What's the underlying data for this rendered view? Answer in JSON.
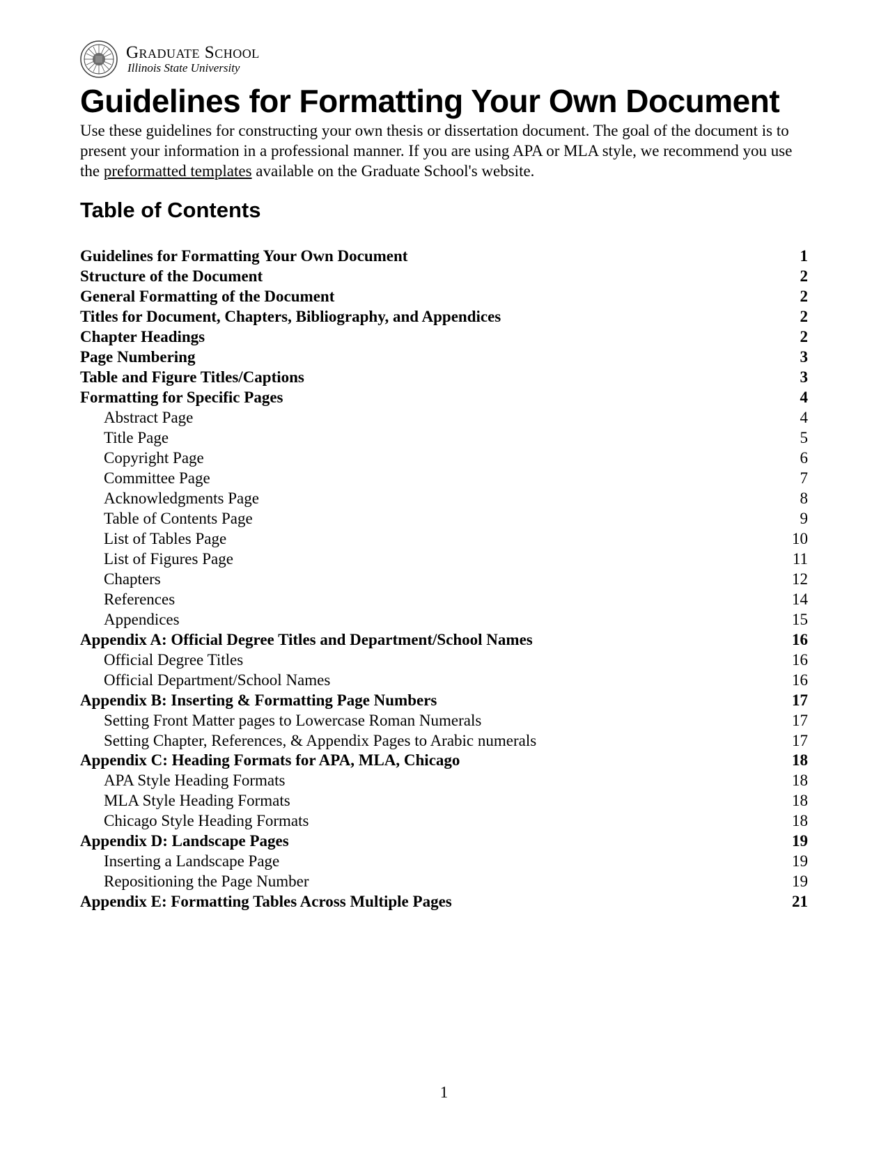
{
  "header": {
    "line1": "Graduate School",
    "line2": "Illinois State University"
  },
  "title": "Guidelines for Formatting Your Own Document",
  "intro": {
    "before_link": "Use these guidelines for constructing your own thesis or dissertation document. The goal of the document is to present your information in a professional manner. If you are using APA or MLA style, we recommend you use the ",
    "link_text": "preformatted templates",
    "after_link": " available on the Graduate School's website."
  },
  "toc_heading": "Table of Contents",
  "toc": [
    {
      "label": "Guidelines for Formatting Your Own Document",
      "page": "1",
      "bold": true,
      "indent": false
    },
    {
      "label": "Structure of the Document",
      "page": "2",
      "bold": true,
      "indent": false
    },
    {
      "label": "General Formatting of the Document",
      "page": "2",
      "bold": true,
      "indent": false
    },
    {
      "label": "Titles for Document, Chapters, Bibliography, and Appendices",
      "page": "2",
      "bold": true,
      "indent": false
    },
    {
      "label": "Chapter Headings",
      "page": "2",
      "bold": true,
      "indent": false
    },
    {
      "label": "Page Numbering",
      "page": "3",
      "bold": true,
      "indent": false
    },
    {
      "label": "Table and Figure Titles/Captions",
      "page": "3",
      "bold": true,
      "indent": false
    },
    {
      "label": "Formatting for Specific Pages",
      "page": "4",
      "bold": true,
      "indent": false
    },
    {
      "label": "Abstract Page",
      "page": "4",
      "bold": false,
      "indent": true
    },
    {
      "label": "Title Page",
      "page": "5",
      "bold": false,
      "indent": true
    },
    {
      "label": "Copyright Page",
      "page": "6",
      "bold": false,
      "indent": true
    },
    {
      "label": "Committee Page",
      "page": "7",
      "bold": false,
      "indent": true
    },
    {
      "label": "Acknowledgments Page",
      "page": "8",
      "bold": false,
      "indent": true
    },
    {
      "label": "Table of Contents Page",
      "page": "9",
      "bold": false,
      "indent": true
    },
    {
      "label": "List of Tables Page",
      "page": "10",
      "bold": false,
      "indent": true
    },
    {
      "label": "List of Figures Page",
      "page": "11",
      "bold": false,
      "indent": true
    },
    {
      "label": "Chapters",
      "page": "12",
      "bold": false,
      "indent": true
    },
    {
      "label": "References",
      "page": "14",
      "bold": false,
      "indent": true
    },
    {
      "label": "Appendices",
      "page": "15",
      "bold": false,
      "indent": true
    },
    {
      "label": "Appendix A: Official Degree Titles and Department/School Names",
      "page": "16",
      "bold": true,
      "indent": false
    },
    {
      "label": "Official Degree Titles",
      "page": "16",
      "bold": false,
      "indent": true
    },
    {
      "label": "Official Department/School Names",
      "page": "16",
      "bold": false,
      "indent": true
    },
    {
      "label": "Appendix B: Inserting & Formatting Page Numbers",
      "page": "17",
      "bold": true,
      "indent": false
    },
    {
      "label": "Setting Front Matter pages to Lowercase Roman Numerals",
      "page": "17",
      "bold": false,
      "indent": true
    },
    {
      "label": "Setting Chapter, References, & Appendix Pages to Arabic numerals",
      "page": "17",
      "bold": false,
      "indent": true
    },
    {
      "label": "Appendix C: Heading Formats for APA, MLA, Chicago",
      "page": "18",
      "bold": true,
      "indent": false
    },
    {
      "label": "APA Style Heading Formats",
      "page": "18",
      "bold": false,
      "indent": true
    },
    {
      "label": "MLA Style Heading Formats",
      "page": "18",
      "bold": false,
      "indent": true
    },
    {
      "label": "Chicago Style Heading Formats",
      "page": "18",
      "bold": false,
      "indent": true
    },
    {
      "label": "Appendix D: Landscape Pages",
      "page": "19",
      "bold": true,
      "indent": false
    },
    {
      "label": "Inserting a Landscape Page",
      "page": "19",
      "bold": false,
      "indent": true
    },
    {
      "label": "Repositioning the Page Number",
      "page": "19",
      "bold": false,
      "indent": true
    },
    {
      "label": "Appendix E: Formatting Tables Across Multiple Pages",
      "page": "21",
      "bold": true,
      "indent": false
    }
  ],
  "page_number": "1"
}
